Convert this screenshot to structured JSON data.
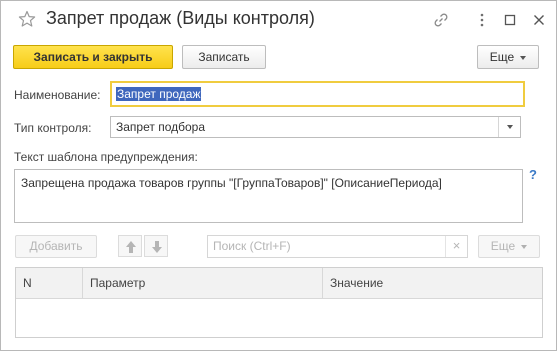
{
  "window": {
    "title": "Запрет продаж (Виды контроля)",
    "icons": [
      "star-icon",
      "link-icon",
      "more-vertical-icon",
      "maximize-icon",
      "close-icon"
    ]
  },
  "toolbar": {
    "save_close_label": "Записать и закрыть",
    "save_label": "Записать",
    "more_label": "Еще"
  },
  "form": {
    "name_label": "Наименование:",
    "name_value": "Запрет продаж",
    "control_type_label": "Тип контроля:",
    "control_type_value": "Запрет подбора",
    "template_label": "Текст шаблона предупреждения:",
    "template_value": "Запрещена продажа товаров группы \"[ГруппаТоваров]\" [ОписаниеПериода]",
    "help_mark": "?"
  },
  "table_toolbar": {
    "add_label": "Добавить",
    "search_placeholder": "Поиск (Ctrl+F)",
    "clear_glyph": "×",
    "more_label": "Еще"
  },
  "table": {
    "columns": [
      "N",
      "Параметр",
      "Значение"
    ],
    "rows": []
  },
  "colors": {
    "primary_button": "#f7cd18",
    "focus_border": "#f0cc3f",
    "selection": "#3f67bd",
    "help": "#3b7ac7"
  }
}
